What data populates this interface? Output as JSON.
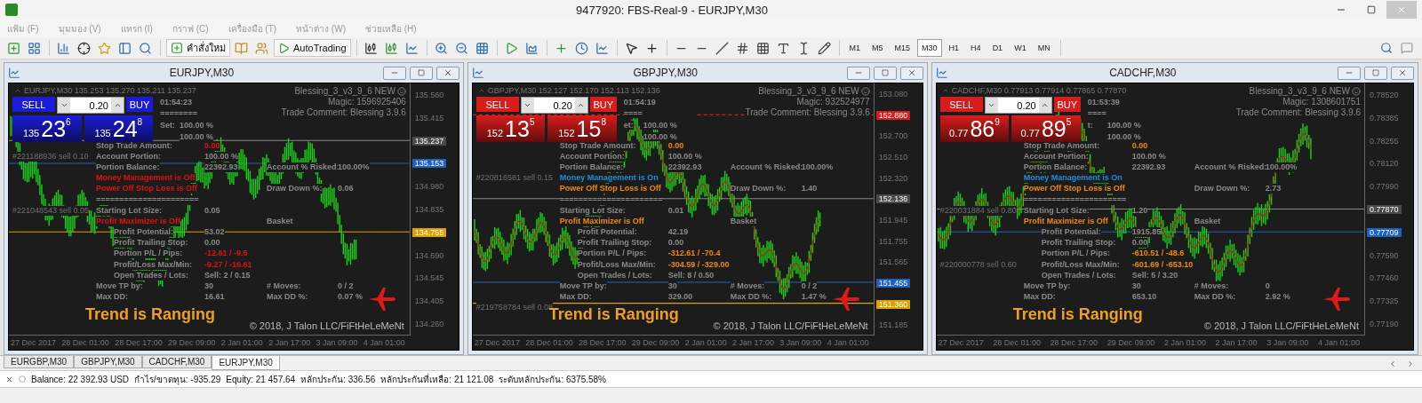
{
  "window": {
    "title": "9477920: FBS-Real-9 - EURJPY,M30"
  },
  "menu": [
    "แฟ้ม (F)",
    "มุมมอง (V)",
    "แทรก (I)",
    "กราฟ (C)",
    "เครื่องมือ (T)",
    "หน้าต่าง (W)",
    "ช่วยเหลือ (H)"
  ],
  "toolbar": {
    "new_order": "คำสั่งใหม่",
    "auto_trading": "AutoTrading",
    "timeframes": [
      {
        "label": "M1",
        "selected": false
      },
      {
        "label": "M5",
        "selected": false
      },
      {
        "label": "M15",
        "selected": false
      },
      {
        "label": "M30",
        "selected": true
      },
      {
        "label": "H1",
        "selected": false
      },
      {
        "label": "H4",
        "selected": false
      },
      {
        "label": "D1",
        "selected": false
      },
      {
        "label": "W1",
        "selected": false
      },
      {
        "label": "MN",
        "selected": false
      }
    ]
  },
  "charts": [
    {
      "title": "EURJPY,M30",
      "header": "EURJPY,M30  135.253 135.270 135.211 135.237",
      "color": "#1c1cd8",
      "moving_average": false,
      "ea": {
        "name": "Blessing_3_v3_9_6 NEW",
        "magic": "Magic: 1596925406",
        "comment": "Trade Comment: Blessing 3.9.6"
      },
      "panel": {
        "sell": "SELL",
        "buy": "BUY",
        "lot": "0.20",
        "bid": {
          "prefix": "135",
          "big": "23",
          "sup": "6"
        },
        "ask": {
          "prefix": "135",
          "big": "24",
          "sup": "8"
        }
      },
      "timer": "01:54:23",
      "separator": "========",
      "set": [
        {
          "label": "Set:",
          "value": "100.00  %"
        },
        {
          "value": "100.00  %"
        }
      ],
      "rows": [
        {
          "label": "Stop Trade Amount:",
          "value": {
            "text": "0.00",
            "color": "#e01010"
          }
        },
        {
          "order": "#221188936 sell 0.10",
          "label": "Account Portion:",
          "value": "100.00  %"
        },
        {
          "label": "Portion Balance:",
          "value": "22392.93",
          "label2": "Account % Risked:",
          "value2": "100.00%"
        },
        {
          "label": {
            "text": "Money Management is Off",
            "color": "#e01010"
          }
        },
        {
          "label": {
            "text": "Power Off Stop Loss is Off",
            "color": "#e01010"
          },
          "label2": "Draw Down %:",
          "value2": "0.06"
        },
        {
          "label": "======================"
        },
        {
          "order": "#221048543 sell 0.05",
          "label": "Starting Lot Size:",
          "value": "0.05"
        },
        {
          "label": {
            "text": "Profit Maximizer is Off",
            "color": "#e01010"
          },
          "label2": "Basket"
        },
        {
          "kind": "basket",
          "label": "Profit Potential:",
          "value": "53.02"
        },
        {
          "kind": "basket",
          "label": "Profit Trailing Stop:",
          "value": "0.00"
        },
        {
          "kind": "basket",
          "label": "Portion P/L / Pips:",
          "value": {
            "text": "-12.61   / -9.5",
            "color": "#e01010"
          }
        },
        {
          "kind": "basket",
          "label": "Profit/Loss Max/Min:",
          "value": {
            "text": "-9.27   / -16.61",
            "color": "#e01010"
          }
        },
        {
          "kind": "basket",
          "label": "Open Trades / Lots:",
          "value": "Sell:   2  / 0.15"
        },
        {
          "label": "Move TP by:",
          "value": "30",
          "label2": "# Moves:",
          "value2": "0  / 2"
        },
        {
          "label": "Max DD:",
          "value": "16.61",
          "label2": "Max DD %:",
          "value2": "0.07  %"
        }
      ],
      "price_axis": [
        {
          "text": "135.560"
        },
        {
          "text": "135.415"
        },
        {
          "text": "135.237",
          "color": "#4a4a4a"
        },
        {
          "text": "135.153",
          "color": "#2060c0"
        },
        {
          "text": "134.980"
        },
        {
          "text": "134.835"
        },
        {
          "text": "134.755",
          "color": "#e0a000"
        },
        {
          "text": "134.690"
        },
        {
          "text": "134.545"
        },
        {
          "text": "134.405"
        },
        {
          "text": "134.260"
        }
      ],
      "time_axis": [
        "27 Dec 2017",
        "28 Dec 01:00",
        "28 Dec 17:00",
        "29 Dec 09:00",
        "2 Jan 01:00",
        "2 Jan 17:00",
        "3 Jan 09:00",
        "4 Jan 01:00"
      ],
      "trend": "Trend is Ranging",
      "copyright": "© 2018, J Talon LLC/FiFtHeLeMeNt"
    },
    {
      "title": "GBPJPY,M30",
      "header": "GBPJPY,M30  152.127 152.170 152.113 152.136",
      "color": "#d81c1c",
      "moving_average": true,
      "ea": {
        "name": "Blessing_3_v3_9_6 NEW",
        "magic": "Magic:  932524977",
        "comment": "Trade Comment: Blessing 3.9.6"
      },
      "panel": {
        "sell": "SELL",
        "buy": "BUY",
        "lot": "0.20",
        "bid": {
          "prefix": "152",
          "big": "13",
          "sup": "5"
        },
        "ask": {
          "prefix": "152",
          "big": "15",
          "sup": "8"
        }
      },
      "timer": "01:54:19",
      "separator": "====",
      "set": [
        {
          "label": "et:",
          "value": "100.00  %"
        },
        {
          "value": "100.00  %"
        }
      ],
      "rows": [
        {
          "label": "Stop Trade Amount:",
          "value": {
            "text": "0.00",
            "color": "#f08a10"
          }
        },
        {
          "label": "Account Portion:",
          "value": "100.00  %"
        },
        {
          "label": "Portion Balance:",
          "value": "22392.93",
          "label2": "Account % Risked:",
          "value2": "100.00%"
        },
        {
          "order": "#220816581 sell 0.15",
          "label": {
            "text": "Money Management is On",
            "color": "#1a8fe0"
          }
        },
        {
          "label": {
            "text": "Power Off Stop Loss is Off",
            "color": "#f08a10"
          },
          "label2": "Draw Down %:",
          "value2": "1.40"
        },
        {
          "label": "======================"
        },
        {
          "label": "Starting Lot Size:",
          "value": "0.01"
        },
        {
          "label": {
            "text": "Profit Maximizer is Off",
            "color": "#f08a10"
          },
          "label2": "Basket"
        },
        {
          "kind": "basket",
          "label": "Profit Potential:",
          "value": "42.19"
        },
        {
          "kind": "basket",
          "label": "Profit Trailing Stop:",
          "value": "0.00"
        },
        {
          "kind": "basket",
          "label": "Portion P/L / Pips:",
          "value": {
            "text": "-312.61   / -70.4",
            "color": "#f08a10"
          }
        },
        {
          "kind": "basket",
          "label": "Profit/Loss Max/Min:",
          "value": {
            "text": "-304.59   / -329.00",
            "color": "#f08a10"
          }
        },
        {
          "kind": "basket",
          "label": "Open Trades / Lots:",
          "value": "Sell:   8  / 0.50"
        },
        {
          "label": "Move TP by:",
          "value": "30",
          "label2": "# Moves:",
          "value2": "0  / 2"
        },
        {
          "label": "Max DD:",
          "value": "329.00",
          "label2": "Max DD %:",
          "value2": "1.47  %"
        },
        {
          "order": "#219758784 sell 0.08"
        }
      ],
      "price_axis": [
        {
          "text": "153.080"
        },
        {
          "text": "152.880",
          "color": "#d81c1c"
        },
        {
          "text": "152.700"
        },
        {
          "text": "152.510"
        },
        {
          "text": "152.320"
        },
        {
          "text": "152.136",
          "color": "#4a4a4a"
        },
        {
          "text": "151.945"
        },
        {
          "text": "151.755"
        },
        {
          "text": "151.565"
        },
        {
          "text": "151.455",
          "color": "#2060c0"
        },
        {
          "text": "151.360",
          "color": "#e0a000"
        },
        {
          "text": "151.185"
        }
      ],
      "time_axis": [
        "27 Dec 2017",
        "28 Dec 01:00",
        "28 Dec 17:00",
        "29 Dec 09:00",
        "2 Jan 01:00",
        "2 Jan 17:00",
        "3 Jan 09:00",
        "4 Jan 01:00"
      ],
      "trend": "Trend is Ranging",
      "copyright": "© 2018, J Talon LLC/FiFtHeLeMeNt"
    },
    {
      "title": "CADCHF,M30",
      "header": "CADCHF,M30  0.77913 0.77914 0.77865 0.77870",
      "color": "#d81c1c",
      "moving_average": true,
      "ea": {
        "name": "Blessing_3_v3_9_6 NEW",
        "magic": "Magic: 1308601751",
        "comment": "Trade Comment: Blessing 3.9.6"
      },
      "panel": {
        "sell": "SELL",
        "buy": "BUY",
        "lot": "0.20",
        "bid": {
          "prefix": "0.77",
          "big": "86",
          "sup": "9"
        },
        "ask": {
          "prefix": "0.77",
          "big": "89",
          "sup": "5"
        }
      },
      "timer": "01:53:39",
      "separator": "====",
      "set": [
        {
          "label": "t:",
          "value": "100.00  %"
        },
        {
          "value": "100.00  %"
        }
      ],
      "rows": [
        {
          "label": "Stop Trade Amount:",
          "value": {
            "text": "0.00",
            "color": "#f08a10"
          }
        },
        {
          "label": "Account Portion:",
          "value": "100.00  %"
        },
        {
          "label": "Portion Balance:",
          "value": "22392.93",
          "label2": "Account % Risked:",
          "value2": "100.00%"
        },
        {
          "label": {
            "text": "Money Management is On",
            "color": "#1a8fe0"
          }
        },
        {
          "label": {
            "text": "Power Off Stop Loss is Off",
            "color": "#f08a10"
          },
          "label2": "Draw Down %:",
          "value2": "2.73"
        },
        {
          "label": "======================"
        },
        {
          "order": "#220031884 sell 0.80",
          "label": "Starting Lot Size:",
          "value": "1.20"
        },
        {
          "label": {
            "text": "Profit Maximizer is Off",
            "color": "#f08a10"
          },
          "label2": "Basket"
        },
        {
          "kind": "basket",
          "label": "Profit Potential:",
          "value": "1915.85"
        },
        {
          "kind": "basket",
          "label": "Profit Trailing Stop:",
          "value": "0.00"
        },
        {
          "kind": "basket",
          "label": "Portion P/L / Pips:",
          "value": {
            "text": "-610.51   / -48.6",
            "color": "#f08a10"
          }
        },
        {
          "order": "#220000778 sell 0.60",
          "kind": "basket",
          "label": "Profit/Loss Max/Min:",
          "value": {
            "text": "-601.69   / -653.10",
            "color": "#f08a10"
          }
        },
        {
          "kind": "basket",
          "label": "Open Trades / Lots:",
          "value": "Sell:   5  / 3.20"
        },
        {
          "label": "Move TP by:",
          "value": "30",
          "label2": "# Moves:",
          "value2": "0"
        },
        {
          "label": "Max DD:",
          "value": "653.10",
          "label2": "Max DD %:",
          "value2": "2.92  %"
        }
      ],
      "price_axis": [
        {
          "text": "0.78520"
        },
        {
          "text": "0.78385"
        },
        {
          "text": "0.78255"
        },
        {
          "text": "0.78120"
        },
        {
          "text": "0.77990"
        },
        {
          "text": "0.77870",
          "color": "#4a4a4a"
        },
        {
          "text": "0.77709",
          "color": "#2060c0"
        },
        {
          "text": "0.77590"
        },
        {
          "text": "0.77460"
        },
        {
          "text": "0.77325"
        },
        {
          "text": "0.77190"
        }
      ],
      "time_axis": [
        "27 Dec 2017",
        "28 Dec 01:00",
        "28 Dec 17:00",
        "29 Dec 09:00",
        "2 Jan 01:00",
        "2 Jan 17:00",
        "3 Jan 09:00",
        "4 Jan 01:00"
      ],
      "trend": "Trend is Ranging",
      "copyright": "© 2018, J Talon LLC/FiFtHeLeMeNt"
    }
  ],
  "chart_tabs": [
    {
      "label": "EURGBP,M30",
      "selected": false
    },
    {
      "label": "GBPJPY,M30",
      "selected": false
    },
    {
      "label": "CADCHF,M30",
      "selected": false
    },
    {
      "label": "EURJPY,M30",
      "selected": true
    }
  ],
  "status": [
    "Balance: 22 392.93 USD",
    "กำไร/ขาดทุน: -935.29",
    "Equity: 21 457.64",
    "หลักประกัน: 336.56",
    "หลักประกันที่เหลือ: 21 121.08",
    "ระดับหลักประกัน: 6375.58%"
  ]
}
